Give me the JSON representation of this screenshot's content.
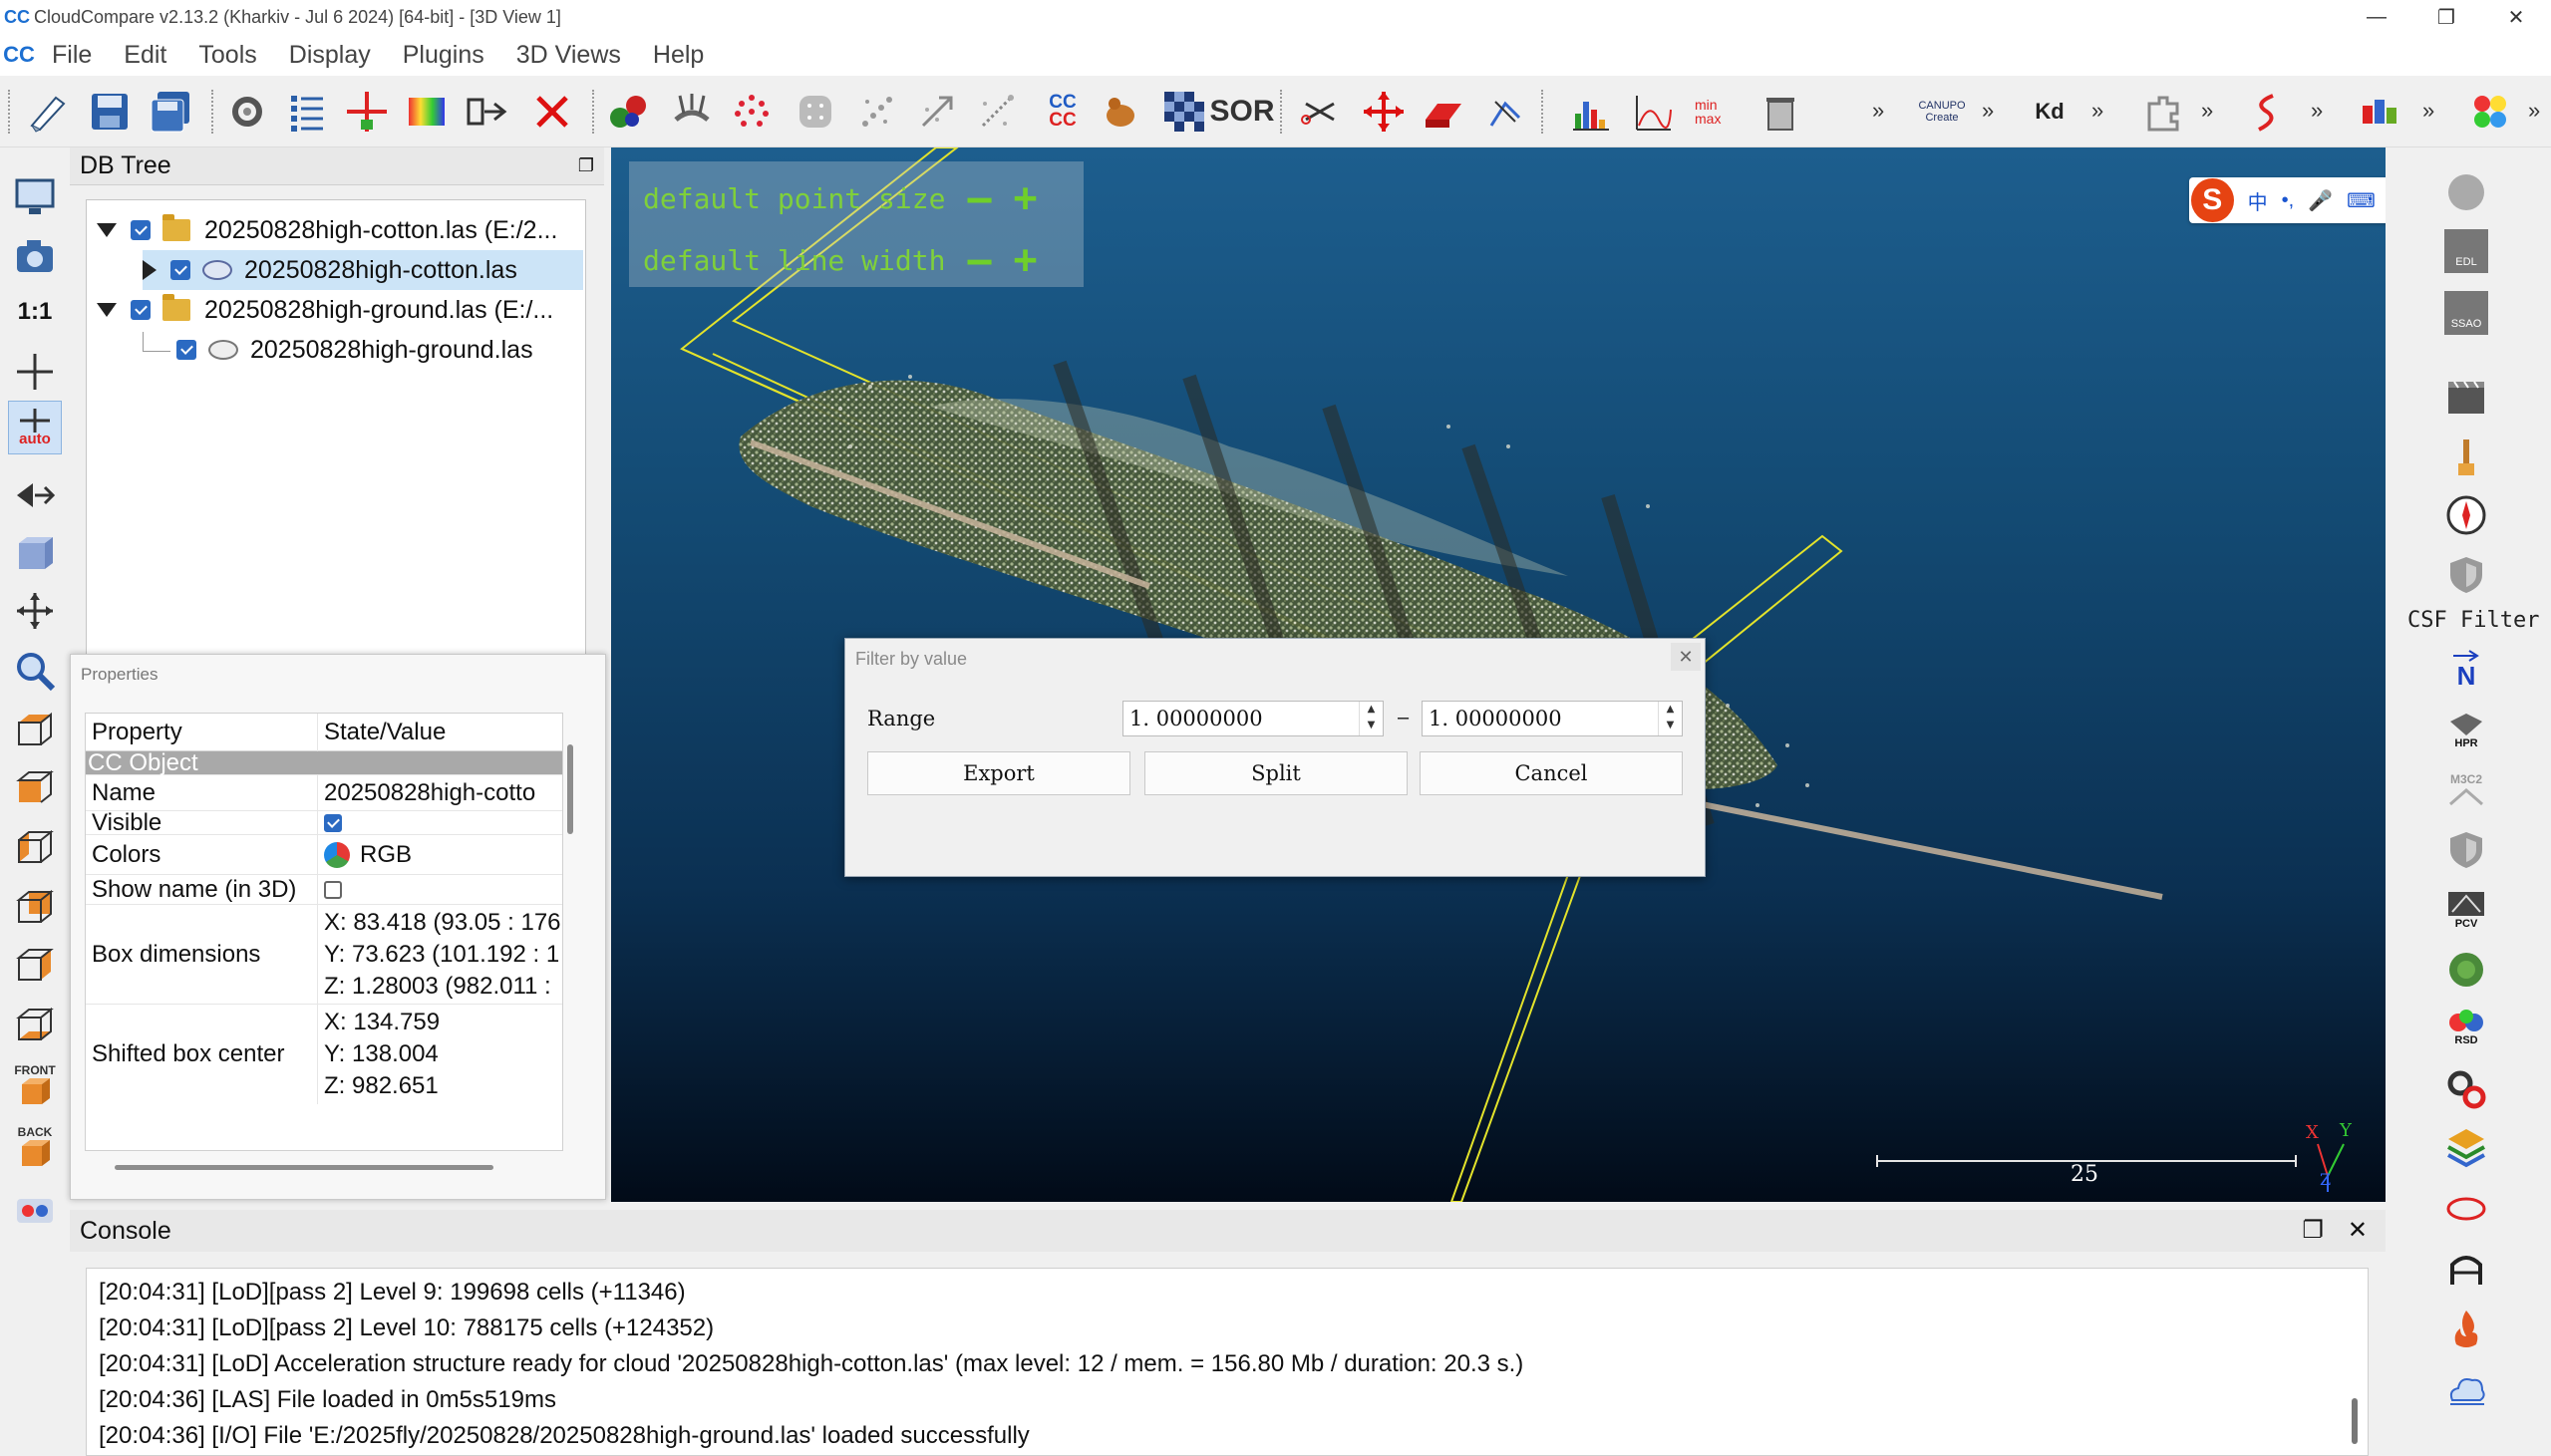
{
  "window": {
    "title": "CloudCompare v2.13.2 (Kharkiv - Jul  6 2024) [64-bit] - [3D View 1]",
    "logo": "CC",
    "controls": [
      "minimize-icon",
      "restore-icon",
      "close-icon"
    ]
  },
  "menu": {
    "items": [
      "File",
      "Edit",
      "Tools",
      "Display",
      "Plugins",
      "3D Views",
      "Help"
    ]
  },
  "toolbar": {
    "cc_label": "CC",
    "sor_label": "SOR",
    "minmax_label": "min max",
    "canupo_label": "CANUPO Create",
    "kd_label": "Kd",
    "more": "»"
  },
  "left_toolbar": {
    "one_to_one": "1:1",
    "auto_label": "auto",
    "front_label": "FRONT",
    "back_label": "BACK"
  },
  "db_tree": {
    "title": "DB Tree",
    "items": [
      {
        "label": "20250828high-cotton.las (E:/2...",
        "type": "folder",
        "expanded": true,
        "checked": true
      },
      {
        "label": "20250828high-cotton.las",
        "type": "cloud",
        "checked": true,
        "selected": true
      },
      {
        "label": "20250828high-ground.las (E:/...",
        "type": "folder",
        "expanded": true,
        "checked": true
      },
      {
        "label": "20250828high-ground.las",
        "type": "cloud",
        "checked": true
      }
    ]
  },
  "properties": {
    "title": "Properties",
    "columns": [
      "Property",
      "State/Value"
    ],
    "section": "CC Object",
    "rows": {
      "name": {
        "label": "Name",
        "value": "20250828high-cotto"
      },
      "visible": {
        "label": "Visible",
        "checked": true
      },
      "colors": {
        "label": "Colors",
        "value": "RGB"
      },
      "show_name": {
        "label": "Show name (in 3D)",
        "checked": false
      },
      "box_dimensions": {
        "label": "Box dimensions",
        "x": "X: 83.418 (93.05 : 176",
        "y": "Y: 73.623 (101.192 : 1",
        "z": "Z: 1.28003 (982.011 :"
      },
      "shifted_center": {
        "label": "Shifted box center",
        "x": "X: 134.759",
        "y": "Y: 138.004",
        "z": "Z: 982.651"
      }
    }
  },
  "view3d": {
    "hud_point_size": "default point size",
    "hud_line_width": "default line width",
    "hud_minus": "—",
    "hud_plus": "+",
    "scale_value": "25",
    "axis_x": "X",
    "axis_y": "Y",
    "axis_z": "Z"
  },
  "filter_dialog": {
    "title": "Filter by value",
    "range_label": "Range",
    "range_min": "1. 00000000",
    "range_max": "1. 00000000",
    "dash": "–",
    "export_label": "Export",
    "split_label": "Split",
    "cancel_label": "Cancel",
    "close": "✕"
  },
  "right_toolbar": {
    "csf_label": "CSF Filter",
    "north_label": "N",
    "edl_label": "EDL",
    "ssao_label": "SSAO",
    "hpr_label": "HPR",
    "m3c2_label": "M3C2",
    "pcv_label": "PCV",
    "rsd_label": "RSD"
  },
  "ime": {
    "logo": "S",
    "items": [
      "中",
      "•,",
      "🎤",
      "⌨",
      "👕",
      "✿",
      "▱"
    ]
  },
  "console": {
    "title": "Console",
    "lines": [
      "[20:04:31] [LoD][pass 2] Level 9: 199698 cells (+11346)",
      "[20:04:31] [LoD][pass 2] Level 10: 788175 cells (+124352)",
      "[20:04:31] [LoD] Acceleration structure ready for cloud '20250828high-cotton.las' (max level: 12 / mem. = 156.80 Mb / duration: 20.3 s.)",
      "[20:04:36] [LAS] File loaded in 0m5s519ms",
      "[20:04:36] [I/O] File 'E:/2025fly/20250828/20250828high-ground.las' loaded successfully"
    ]
  }
}
